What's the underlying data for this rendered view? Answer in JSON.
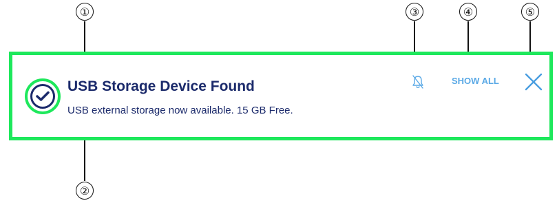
{
  "callouts": [
    "①",
    "②",
    "③",
    "④",
    "⑤"
  ],
  "notification": {
    "title": "USB Storage Device Found",
    "message": "USB external storage now available. 15 GB Free.",
    "show_all_label": "SHOW ALL",
    "status_icon": "check-circle-icon",
    "mute_icon": "bell-off-icon",
    "close_icon": "close-icon"
  },
  "colors": {
    "highlight": "#1ee85c",
    "text_primary": "#1b2a6b",
    "accent": "#5aa9e6"
  }
}
